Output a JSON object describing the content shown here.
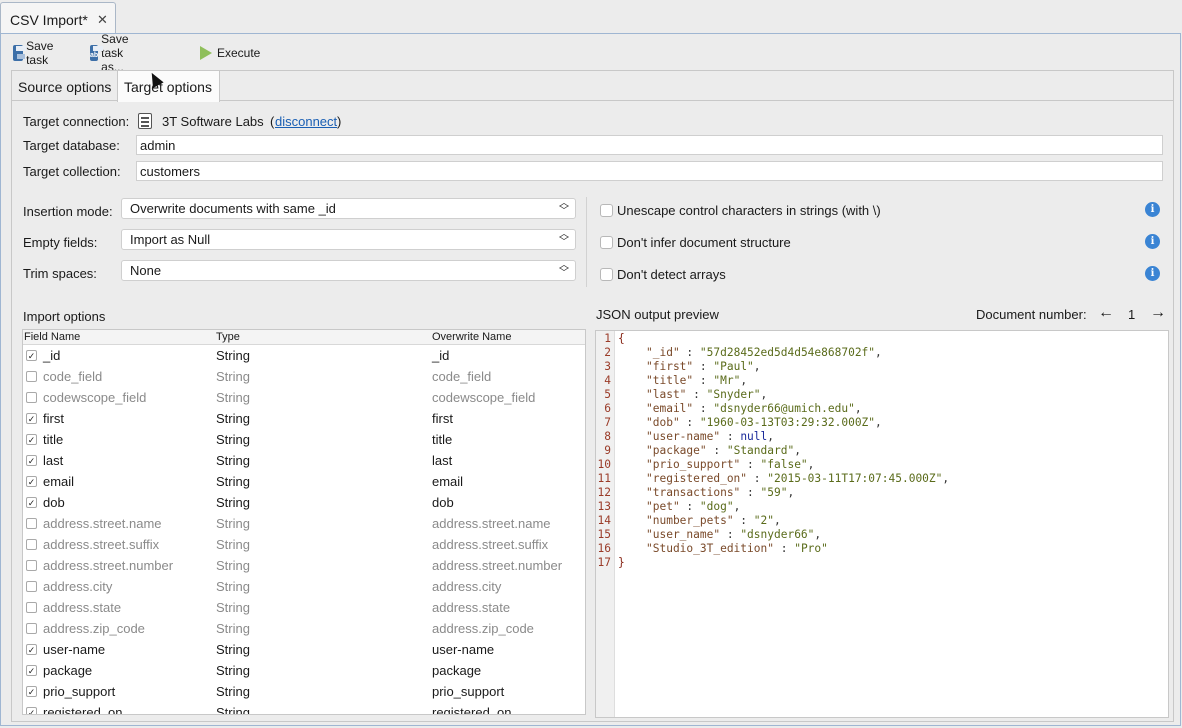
{
  "doc_tab": {
    "title": "CSV Import*",
    "close": "✕"
  },
  "toolbar": {
    "save": "Save task",
    "save_as": "Save task as...",
    "execute": "Execute"
  },
  "subtabs": [
    "Source options",
    "Target options"
  ],
  "target": {
    "connection_label": "Target connection:",
    "connection_name": "3T Software Labs",
    "open_paren": "(",
    "disconnect": "disconnect",
    "close_paren": ")",
    "database_label": "Target database:",
    "database": "admin",
    "collection_label": "Target collection:",
    "collection": "customers"
  },
  "modes": {
    "insertion_label": "Insertion mode:",
    "insertion": "Overwrite documents with same _id",
    "empty_label": "Empty fields:",
    "empty": "Import as Null",
    "trim_label": "Trim spaces:",
    "trim": "None"
  },
  "options": [
    {
      "label": "Unescape control characters in strings (with \\)",
      "checked": false
    },
    {
      "label": "Don't infer document structure",
      "checked": false
    },
    {
      "label": "Don't detect arrays",
      "checked": false
    }
  ],
  "import_options": {
    "title": "Import options",
    "headers": [
      "Field Name",
      "Type",
      "Overwrite Name"
    ],
    "rows": [
      {
        "name": "_id",
        "type": "String",
        "overwrite": "_id",
        "checked": true
      },
      {
        "name": "code_field",
        "type": "String",
        "overwrite": "code_field",
        "checked": false
      },
      {
        "name": "codewscope_field",
        "type": "String",
        "overwrite": "codewscope_field",
        "checked": false
      },
      {
        "name": "first",
        "type": "String",
        "overwrite": "first",
        "checked": true
      },
      {
        "name": "title",
        "type": "String",
        "overwrite": "title",
        "checked": true
      },
      {
        "name": "last",
        "type": "String",
        "overwrite": "last",
        "checked": true
      },
      {
        "name": "email",
        "type": "String",
        "overwrite": "email",
        "checked": true
      },
      {
        "name": "dob",
        "type": "String",
        "overwrite": "dob",
        "checked": true
      },
      {
        "name": "address.street.name",
        "type": "String",
        "overwrite": "address.street.name",
        "checked": false
      },
      {
        "name": "address.street.suffix",
        "type": "String",
        "overwrite": "address.street.suffix",
        "checked": false
      },
      {
        "name": "address.street.number",
        "type": "String",
        "overwrite": "address.street.number",
        "checked": false
      },
      {
        "name": "address.city",
        "type": "String",
        "overwrite": "address.city",
        "checked": false
      },
      {
        "name": "address.state",
        "type": "String",
        "overwrite": "address.state",
        "checked": false
      },
      {
        "name": "address.zip_code",
        "type": "String",
        "overwrite": "address.zip_code",
        "checked": false
      },
      {
        "name": "user-name",
        "type": "String",
        "overwrite": "user-name",
        "checked": true
      },
      {
        "name": "package",
        "type": "String",
        "overwrite": "package",
        "checked": true
      },
      {
        "name": "prio_support",
        "type": "String",
        "overwrite": "prio_support",
        "checked": true
      },
      {
        "name": "registered_on",
        "type": "String",
        "overwrite": "registered_on",
        "checked": true
      }
    ]
  },
  "preview": {
    "title": "JSON output preview",
    "doc_number_label": "Document number:",
    "prev": "←",
    "doc_number": "1",
    "next": "→",
    "lines": [
      {
        "n": "1",
        "open": "{"
      },
      {
        "n": "2",
        "key": "\"_id\"",
        "val": "\"57d28452ed5d4d54e868702f\"",
        "t": "s",
        "comma": ","
      },
      {
        "n": "3",
        "key": "\"first\"",
        "val": "\"Paul\"",
        "t": "s",
        "comma": ","
      },
      {
        "n": "4",
        "key": "\"title\"",
        "val": "\"Mr\"",
        "t": "s",
        "comma": ","
      },
      {
        "n": "5",
        "key": "\"last\"",
        "val": "\"Snyder\"",
        "t": "s",
        "comma": ","
      },
      {
        "n": "6",
        "key": "\"email\"",
        "val": "\"dsnyder66@umich.edu\"",
        "t": "s",
        "comma": ","
      },
      {
        "n": "7",
        "key": "\"dob\"",
        "val": "\"1960-03-13T03:29:32.000Z\"",
        "t": "s",
        "comma": ","
      },
      {
        "n": "8",
        "key": "\"user-name\"",
        "val": "null",
        "t": "nl",
        "comma": ","
      },
      {
        "n": "9",
        "key": "\"package\"",
        "val": "\"Standard\"",
        "t": "s",
        "comma": ","
      },
      {
        "n": "10",
        "key": "\"prio_support\"",
        "val": "\"false\"",
        "t": "s",
        "comma": ","
      },
      {
        "n": "11",
        "key": "\"registered_on\"",
        "val": "\"2015-03-11T17:07:45.000Z\"",
        "t": "s",
        "comma": ","
      },
      {
        "n": "12",
        "key": "\"transactions\"",
        "val": "\"59\"",
        "t": "s",
        "comma": ","
      },
      {
        "n": "13",
        "key": "\"pet\"",
        "val": "\"dog\"",
        "t": "s",
        "comma": ","
      },
      {
        "n": "14",
        "key": "\"number_pets\"",
        "val": "\"2\"",
        "t": "s",
        "comma": ","
      },
      {
        "n": "15",
        "key": "\"user_name\"",
        "val": "\"dsnyder66\"",
        "t": "s",
        "comma": ","
      },
      {
        "n": "16",
        "key": "\"Studio_3T_edition\"",
        "val": "\"Pro\"",
        "t": "s",
        "comma": ""
      },
      {
        "n": "17",
        "open": "}"
      }
    ]
  }
}
